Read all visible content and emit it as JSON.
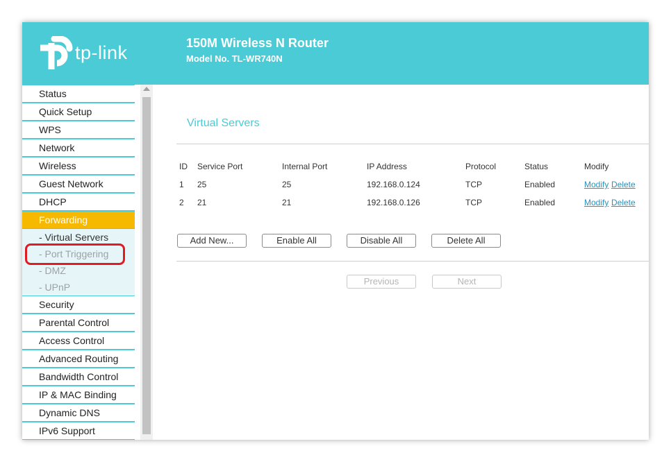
{
  "header": {
    "logo_text": "tp-link",
    "router_title": "150M Wireless N Router",
    "model": "Model No. TL-WR740N"
  },
  "colors": {
    "brand": "#4acbd6",
    "active_menu": "#f7b900",
    "link": "#2e8fb7",
    "annotation": "#e01b24"
  },
  "sidebar": {
    "items_top": [
      "Status",
      "Quick Setup",
      "WPS",
      "Network",
      "Wireless",
      "Guest Network",
      "DHCP"
    ],
    "active": "Forwarding",
    "submenu": [
      "- Virtual Servers",
      "- Port Triggering",
      "- DMZ",
      "- UPnP"
    ],
    "items_bottom": [
      "Security",
      "Parental Control",
      "Access Control",
      "Advanced Routing",
      "Bandwidth Control",
      "IP & MAC Binding",
      "Dynamic DNS",
      "IPv6 Support"
    ]
  },
  "main": {
    "title": "Virtual Servers",
    "columns": [
      "ID",
      "Service Port",
      "Internal Port",
      "IP Address",
      "Protocol",
      "Status",
      "Modify"
    ],
    "rows": [
      {
        "id": "1",
        "service_port": "25",
        "internal_port": "25",
        "ip": "192.168.0.124",
        "protocol": "TCP",
        "status": "Enabled",
        "modify": "Modify",
        "delete": "Delete"
      },
      {
        "id": "2",
        "service_port": "21",
        "internal_port": "21",
        "ip": "192.168.0.126",
        "protocol": "TCP",
        "status": "Enabled",
        "modify": "Modify",
        "delete": "Delete"
      }
    ],
    "buttons": {
      "add_new": "Add New...",
      "enable_all": "Enable All",
      "disable_all": "Disable All",
      "delete_all": "Delete All",
      "previous": "Previous",
      "next": "Next"
    }
  }
}
